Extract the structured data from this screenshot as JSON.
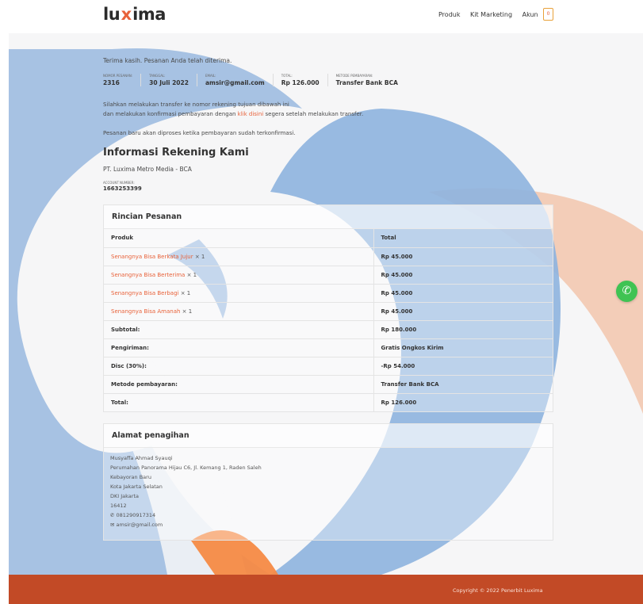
{
  "header": {
    "logo_left": "lu",
    "logo_x": "x",
    "logo_right": "ima",
    "nav": [
      "Produk",
      "Kit Marketing",
      "Akun"
    ],
    "cart_count": "0"
  },
  "order_info": {
    "thanks": "Terima kasih. Pesanan Anda telah diterima.",
    "meta": [
      {
        "label": "NOMOR PESANAN:",
        "value": "2316"
      },
      {
        "label": "TANGGAL:",
        "value": "30 Juli 2022"
      },
      {
        "label": "EMAIL:",
        "value": "amsir@gmail.com"
      },
      {
        "label": "TOTAL:",
        "value": "Rp 126.000"
      },
      {
        "label": "METODE PEMBAYARAN:",
        "value": "Transfer Bank BCA"
      }
    ]
  },
  "payment_note": {
    "line1": "Silahkan melakukan transfer ke nomor rekening tujuan dibawah ini",
    "line2_pre": "dan melakukan konfirmasi pembayaran dengan ",
    "line2_link": "klik disini",
    "line2_post": " segera setelah melakukan transfer.",
    "line3": "Pesanan baru akan diproses ketika pembayaran sudah terkonfirmasi."
  },
  "bank": {
    "title": "Informasi Rekening Kami",
    "name": "PT. Luxima Metro Media - BCA",
    "account_label": "ACCOUNT NUMBER:",
    "account_number": "1663253399"
  },
  "order_details": {
    "title": "Rincian Pesanan",
    "col_product": "Produk",
    "col_total": "Total",
    "items": [
      {
        "name": "Senangnya Bisa Berkata Jujur",
        "qty": "× 1",
        "total": "Rp 45.000"
      },
      {
        "name": "Senangnya Bisa Berterima",
        "qty": "× 1",
        "total": "Rp 45.000"
      },
      {
        "name": "Senangnya Bisa Berbagi",
        "qty": "× 1",
        "total": "Rp 45.000"
      },
      {
        "name": "Senangnya Bisa Amanah",
        "qty": "× 1",
        "total": "Rp 45.000"
      }
    ],
    "summary": [
      {
        "label": "Subtotal:",
        "value": "Rp 180.000"
      },
      {
        "label": "Pengiriman:",
        "value": "Gratis Ongkos Kirim"
      },
      {
        "label": "Disc (30%):",
        "value": "-Rp 54.000"
      },
      {
        "label": "Metode pembayaran:",
        "value": "Transfer Bank BCA"
      },
      {
        "label": "Total:",
        "value": "Rp 126.000"
      }
    ]
  },
  "billing": {
    "title": "Alamat penagihan",
    "lines": [
      "Musyaffa Ahmad Syauqi",
      "Perumahan Panorama Hijau C6, Jl. Kemang 1, Raden Saleh",
      "Kebayoran Baru",
      "Kota Jakarta Selatan",
      "DKI Jakarta",
      "16412"
    ],
    "phone": "081290917314",
    "email": "amsir@gmail.com"
  },
  "footer": {
    "copyright": "Copyright © 2022 Penerbit Luxima"
  },
  "colors": {
    "accent": "#e8623a",
    "blue_shape": "#8fb4de",
    "footer_bg": "#c24a26",
    "whatsapp": "#3fc353"
  }
}
